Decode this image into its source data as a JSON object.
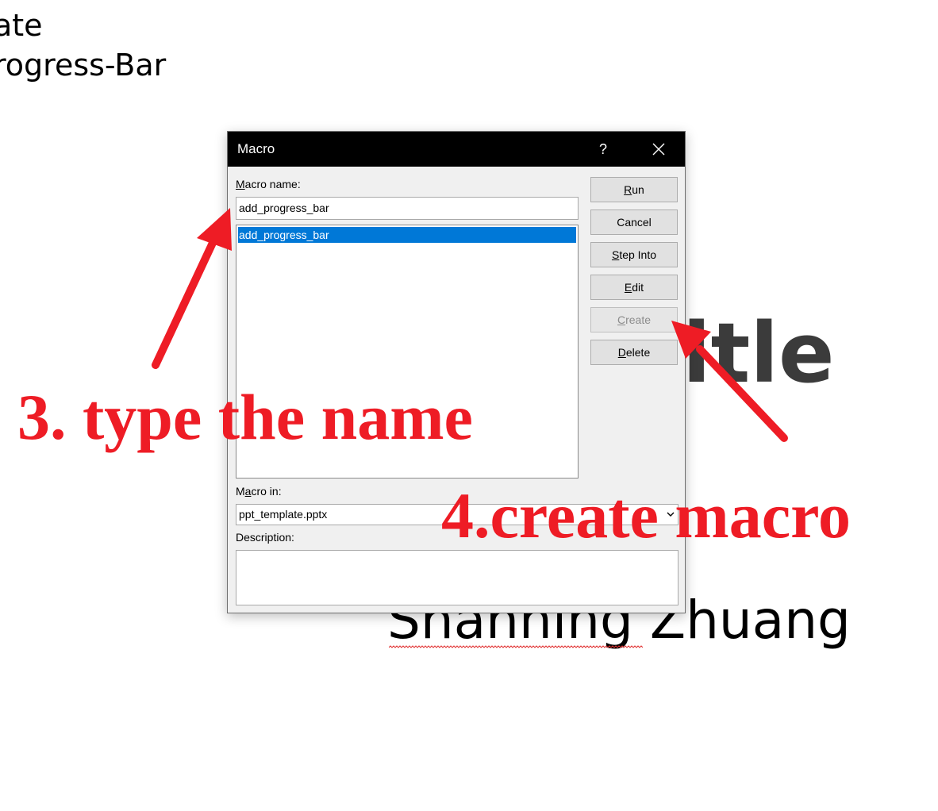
{
  "slide": {
    "line1": "ate",
    "line2": "rogress-Bar",
    "title": "itle",
    "subtitle": "Shanning Zhuang"
  },
  "dialog": {
    "title": "Macro",
    "help_label": "?",
    "close_icon": "close-icon",
    "macro_name_label_mn": "M",
    "macro_name_label_rest": "acro name:",
    "macro_name_value": "add_progress_bar",
    "macro_list": [
      "add_progress_bar"
    ],
    "macro_in_label_pre": "M",
    "macro_in_label_a": "a",
    "macro_in_label_rest": "cro in:",
    "macro_in_value": "ppt_template.pptx",
    "description_label": "Description:",
    "description_value": "",
    "buttons": {
      "run_a": "R",
      "run_b": "un",
      "cancel": "Cancel",
      "step_a": "S",
      "step_b": "tep Into",
      "edit_a": "E",
      "edit_b": "dit",
      "create_a": "C",
      "create_b": "reate",
      "delete_a": "D",
      "delete_b": "elete"
    }
  },
  "annotations": {
    "step3": "3. type the name",
    "step4": "4.create macro",
    "color": "#ee1c25"
  },
  "colors": {
    "selection": "#0078d7",
    "titlebar": "#000000",
    "dialog_bg": "#f0f0f0"
  }
}
